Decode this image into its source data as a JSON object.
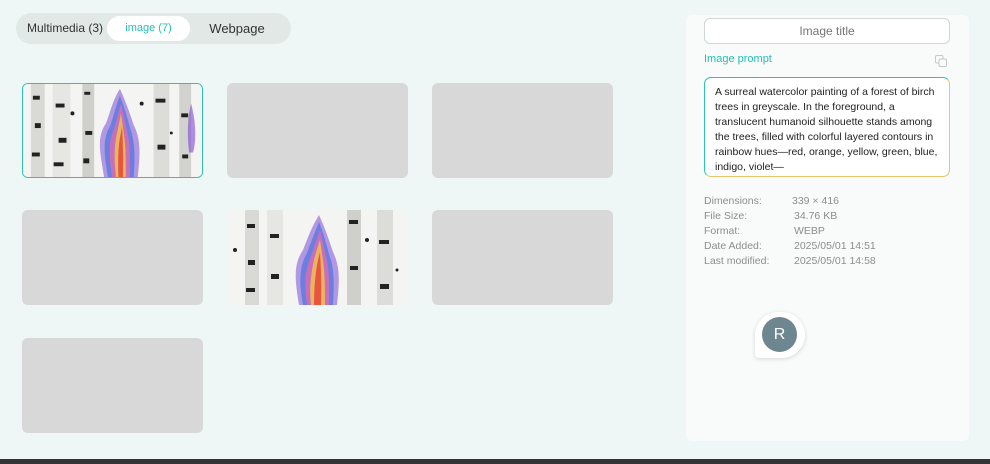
{
  "tabs": [
    {
      "label": "Multimedia (3)"
    },
    {
      "label": "image (7)",
      "active": true
    },
    {
      "label": "Webpage"
    }
  ],
  "thumbnails": [
    {
      "has_image": true,
      "selected": true
    },
    {
      "has_image": false
    },
    {
      "has_image": false
    },
    {
      "has_image": false
    },
    {
      "has_image": true,
      "selected": false
    },
    {
      "has_image": false
    },
    {
      "has_image": false
    }
  ],
  "details": {
    "title_placeholder": "Image title",
    "prompt_label": "Image prompt",
    "prompt_text": "A surreal watercolor painting of a forest of birch trees in greyscale. In the foreground, a translucent humanoid silhouette stands among the trees, filled with colorful layered contours in rainbow hues—red, orange, yellow, green, blue, indigo, violet—",
    "meta": [
      {
        "key": "Dimensions:",
        "value": "339 × 416"
      },
      {
        "key": "File Size:",
        "value": "34.76 KB"
      },
      {
        "key": "Format:",
        "value": "WEBP"
      },
      {
        "key": "Date Added:",
        "value": "2025/05/01 14:51"
      },
      {
        "key": "Last modified:",
        "value": "2025/05/01 14:58"
      }
    ]
  },
  "avatar": {
    "initial": "R"
  },
  "colors": {
    "accent": "#26bfb2",
    "placeholder": "#d8d8d8",
    "avatar": "#6d8690"
  },
  "icons": {
    "copy": "copy-icon"
  }
}
